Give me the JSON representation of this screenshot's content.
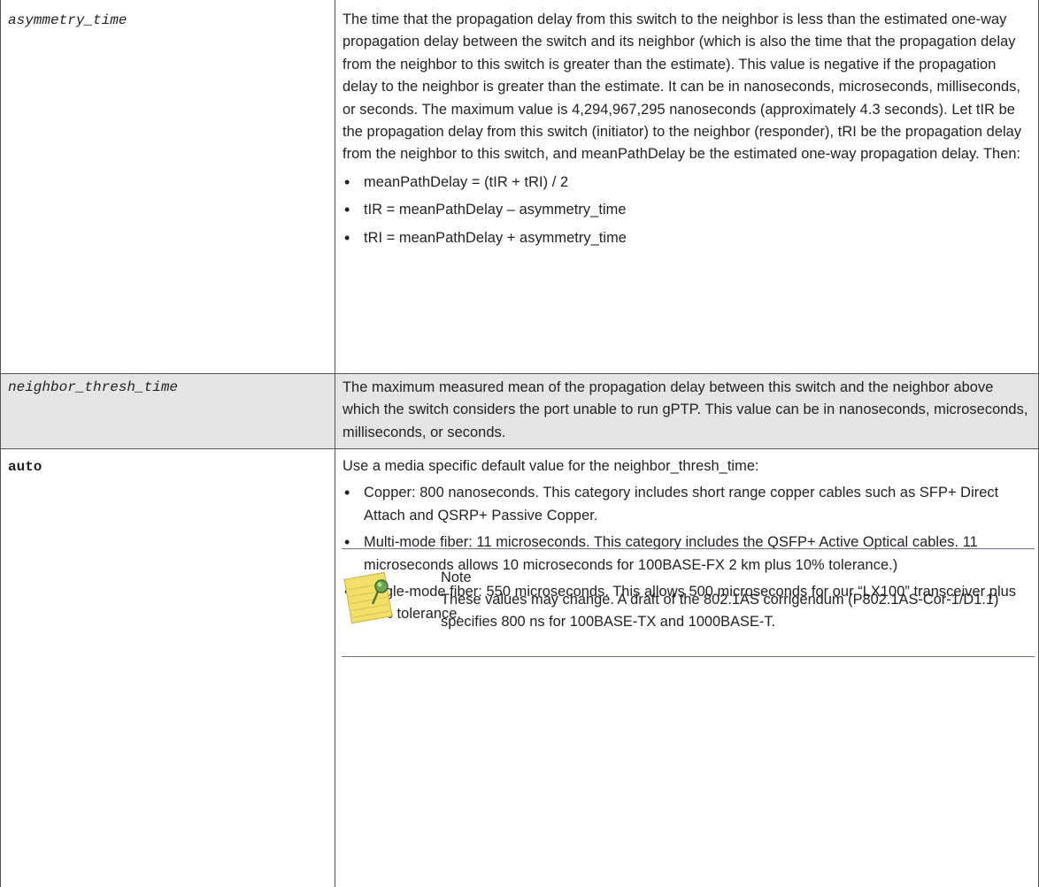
{
  "rows": [
    {
      "term": "asymmetry_time",
      "description": "The time that the propagation delay from this switch to the neighbor is less than the estimated one-way propagation delay between the switch and its neighbor (which is also the time that the propagation delay from the neighbor to this switch is greater than the estimate). This value is negative if the propagation delay to the neighbor is greater than the estimate. It can be in nanoseconds, microseconds, milliseconds, or seconds. The maximum value is 4,294,967,295 nanoseconds (approximately 4.3 seconds). Let tIR be the propagation delay from this switch (initiator) to the neighbor (responder), tRI be the propagation delay from the neighbor to this switch, and meanPathDelay be the estimated one-way propagation delay. Then:",
      "bullets": [
        "meanPathDelay = (tIR + tRI) / 2",
        "tIR = meanPathDelay – asymmetry_time",
        "tRI = meanPathDelay + asymmetry_time"
      ]
    },
    {
      "term": "neighbor_thresh_time",
      "description": "The maximum measured mean of the propagation delay between this switch and the neighbor above which the switch considers the port unable to run gPTP. This value can be in nanoseconds, microseconds, milliseconds, or seconds."
    },
    {
      "term": "auto",
      "description": "Use a media specific default value for the neighbor_thresh_time:",
      "bullets": [
        "Copper: 800 nanoseconds. This category includes short range copper cables such as SFP+ Direct Attach and QSRP+ Passive Copper.",
        "Multi-mode fiber: 11 microseconds. This category includes the QSFP+ Active Optical cables. 11 microseconds allows 10 microseconds for 100BASE-FX 2 km plus 10% tolerance.)",
        "Single-mode fiber: 550 microseconds. This allows 500 microseconds for our “LX100” transceiver plus 10% tolerance."
      ]
    }
  ],
  "note": {
    "title": "Note",
    "text": "These values may change. A draft of the 802.1AS corrigendum (P802.1AS-Cor-1/D1.1) specifies 800 ns for 100BASE-TX and 1000BASE-T.",
    "icon": "note-pad-icon"
  }
}
